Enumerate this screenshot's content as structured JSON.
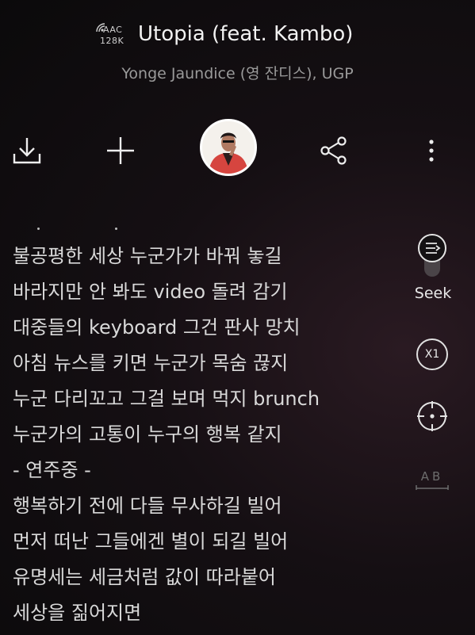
{
  "header": {
    "codec_line1": "AAC",
    "codec_line2": "128K",
    "title": "Utopia (feat. Kambo)",
    "artist": "Yonge Jaundice (영 잔디스), UGP"
  },
  "toolbar": {
    "icons": [
      "download-icon",
      "plus-icon",
      "album-art",
      "share-icon",
      "more-icon"
    ]
  },
  "lyrics": [
    "불공평한 세상 누군가가 바꿔 놓길",
    "바라지만 안 봐도 video 돌려 감기",
    "대중들의 keyboard 그건 판사 망치",
    "아침 뉴스를 키면 누군가 목숨 끊지",
    "누군 다리꼬고 그걸 보며 먹지 brunch",
    "누군가의 고통이 누구의 행복 같지",
    "- 연주중 -",
    "행복하기 전에 다들 무사하길 빌어",
    "먼저 떠난 그들에겐 별이 되길 빌어",
    "유명세는 세금처럼 값이 따라붙어",
    "세상을 짊어지면"
  ],
  "side": {
    "seek_label": "Seek",
    "speed_label": "X1",
    "ab_label": "AB"
  },
  "colors": {
    "background": "#0b0a0b",
    "text": "#e4e4e4",
    "subtext": "#9a9a9a"
  }
}
